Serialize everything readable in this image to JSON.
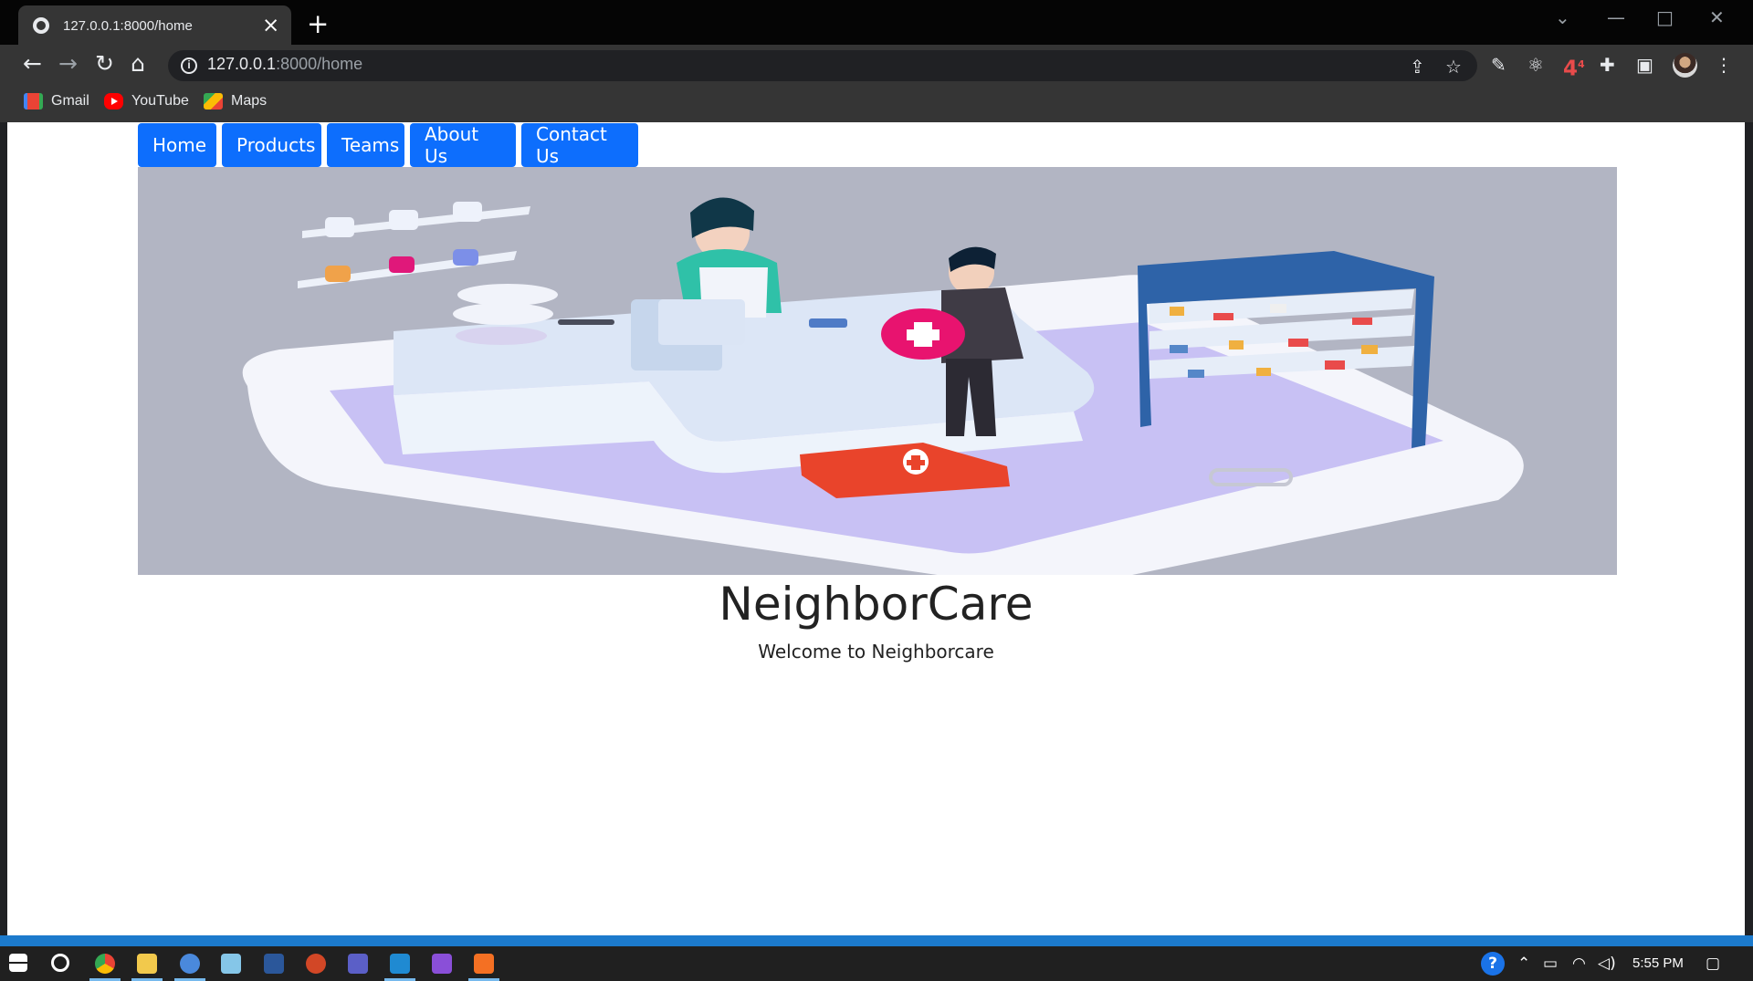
{
  "browser": {
    "tab_title": "127.0.0.1:8000/home",
    "url_host": "127.0.0.1",
    "url_path": ":8000/home",
    "bookmarks": [
      {
        "label": "Gmail",
        "icon": "gmail-icon"
      },
      {
        "label": "YouTube",
        "icon": "youtube-icon"
      },
      {
        "label": "Maps",
        "icon": "maps-icon"
      }
    ],
    "extension_badge": "4",
    "extension_badge_super": "4"
  },
  "page": {
    "nav": [
      "Home",
      "Products",
      "Teams",
      "About Us",
      "Contact Us"
    ],
    "hero_image": "pharmacy-illustration",
    "brand": "NeighborCare",
    "welcome": "Welcome to Neighborcare"
  },
  "taskbar": {
    "time": "5:55 PM"
  },
  "colors": {
    "nav_blue": "#0d6efd",
    "hero_bg": "#b0b4c2",
    "taskbar_bg": "#202020",
    "vscode_blue": "#1c7acc"
  }
}
